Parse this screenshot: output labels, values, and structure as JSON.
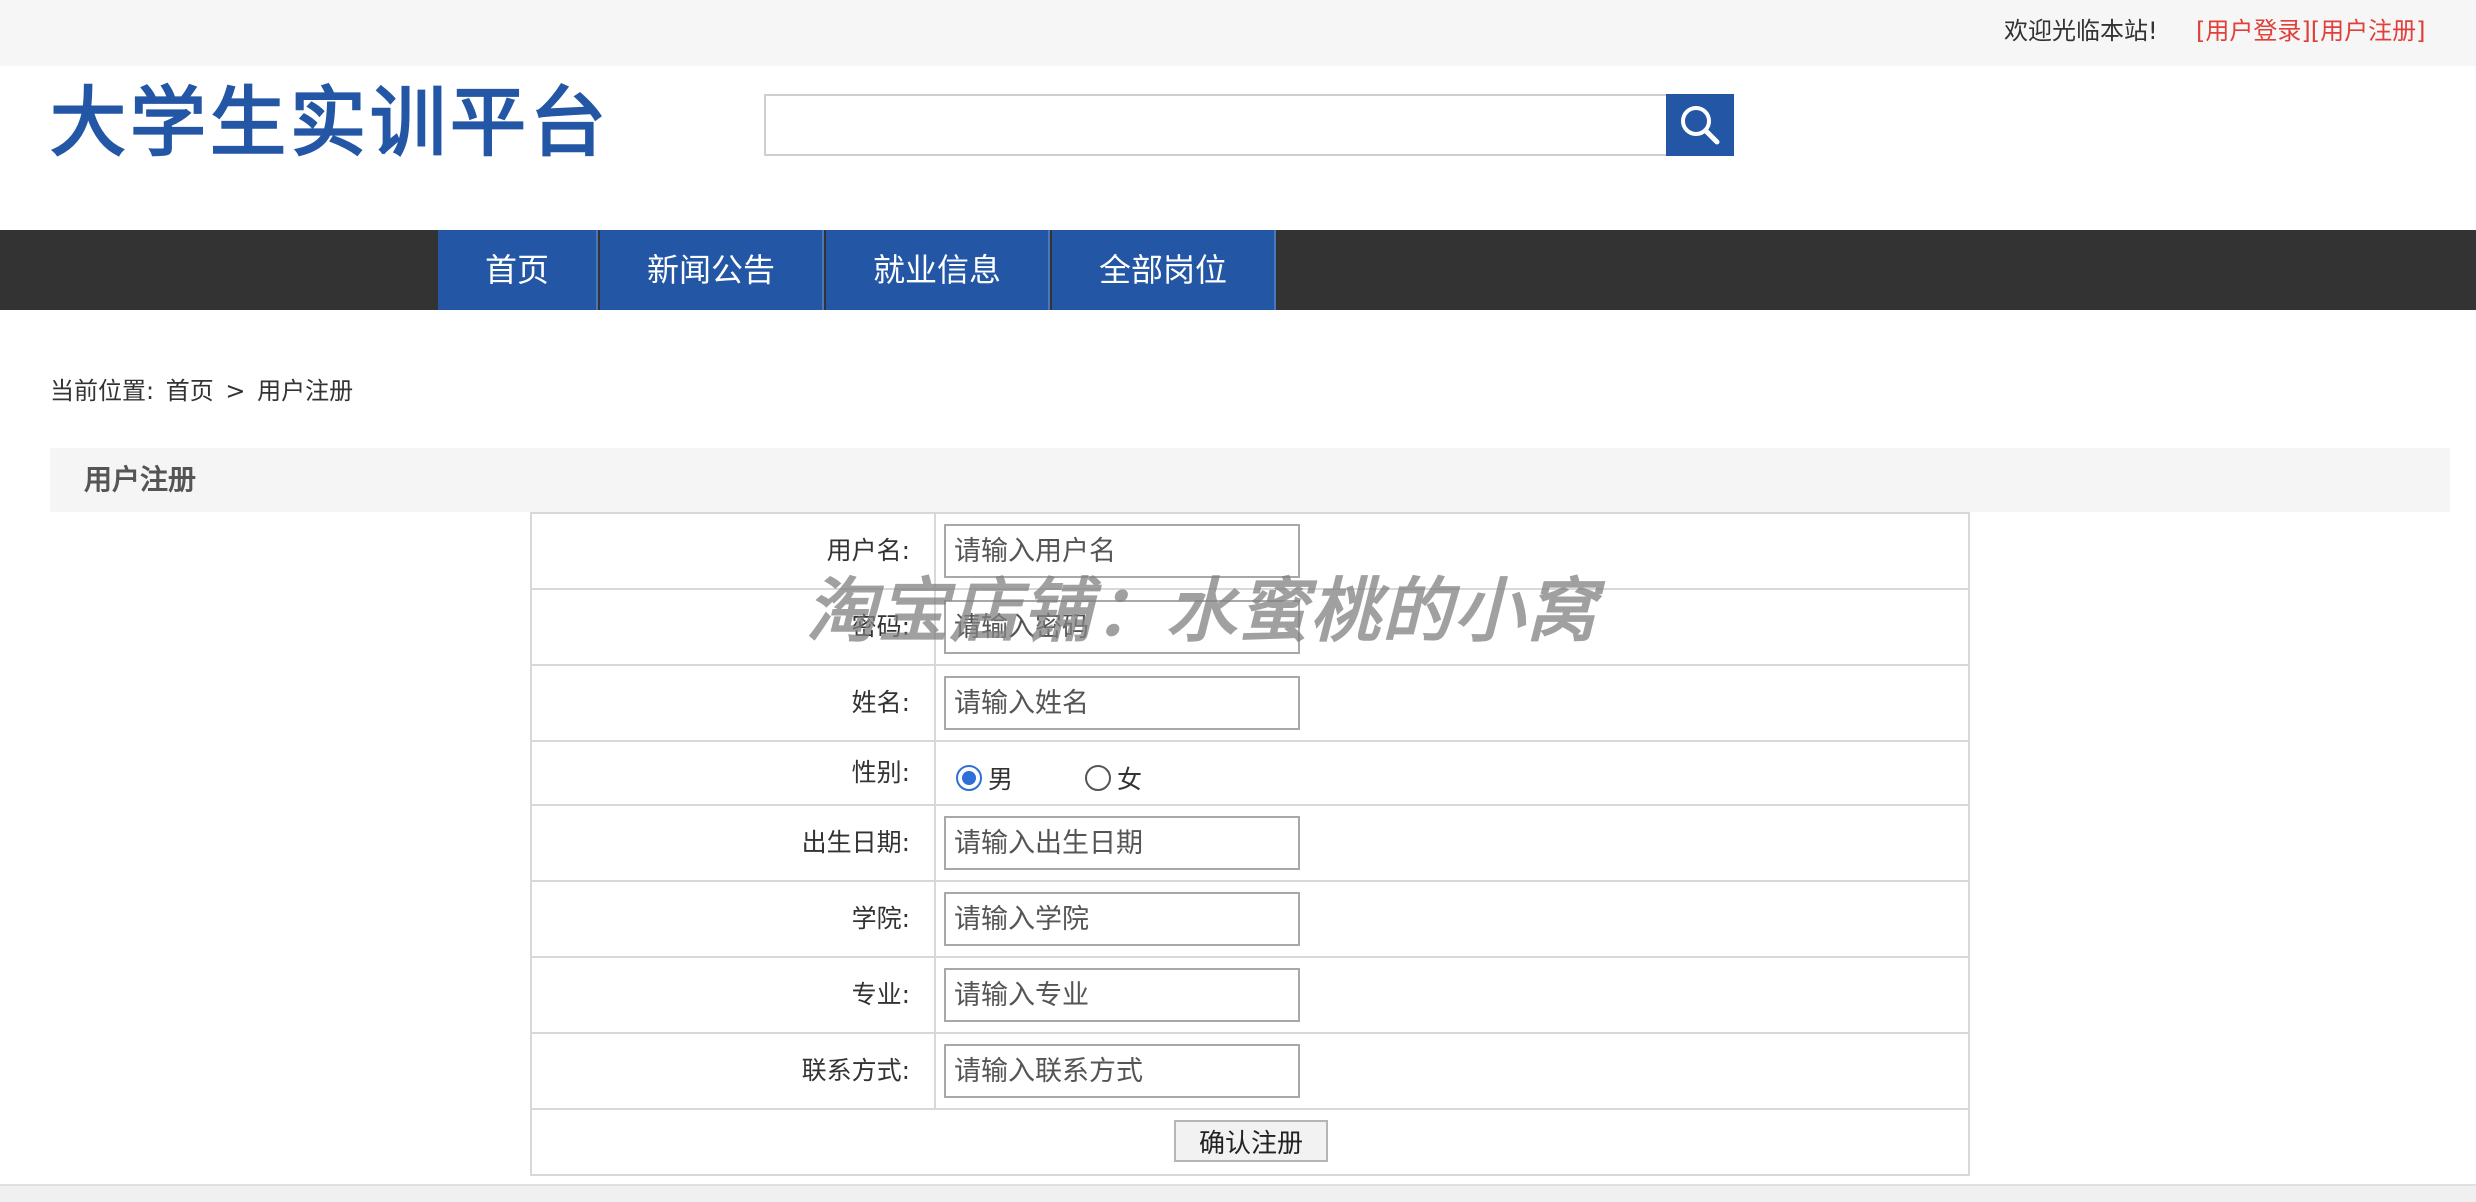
{
  "topbar": {
    "welcome": "欢迎光临本站!",
    "login_link": "[用户登录]",
    "register_link": "[用户注册]"
  },
  "header": {
    "logo": "大学生实训平台",
    "search_placeholder": "",
    "search_icon": "search-icon"
  },
  "nav": {
    "items": [
      {
        "label": "首页"
      },
      {
        "label": "新闻公告"
      },
      {
        "label": "就业信息"
      },
      {
        "label": "全部岗位"
      }
    ]
  },
  "breadcrumb": {
    "prefix": "当前位置:",
    "home": "首页",
    "separator": ">",
    "current": "用户注册"
  },
  "section": {
    "title": "用户注册"
  },
  "form": {
    "username": {
      "label": "用户名:",
      "placeholder": "请输入用户名"
    },
    "password": {
      "label": "密码:",
      "placeholder": "请输入密码"
    },
    "name": {
      "label": "姓名:",
      "placeholder": "请输入姓名"
    },
    "gender": {
      "label": "性别:",
      "male": "男",
      "female": "女",
      "selected": "男"
    },
    "birthdate": {
      "label": "出生日期:",
      "placeholder": "请输入出生日期"
    },
    "college": {
      "label": "学院:",
      "placeholder": "请输入学院"
    },
    "major": {
      "label": "专业:",
      "placeholder": "请输入专业"
    },
    "contact": {
      "label": "联系方式:",
      "placeholder": "请输入联系方式"
    },
    "submit_label": "确认注册"
  },
  "watermark": "淘宝店铺：水蜜桃的小窝",
  "colors": {
    "brand_blue": "#2356a5",
    "nav_dark": "#333333",
    "link_red": "#e0403a"
  }
}
